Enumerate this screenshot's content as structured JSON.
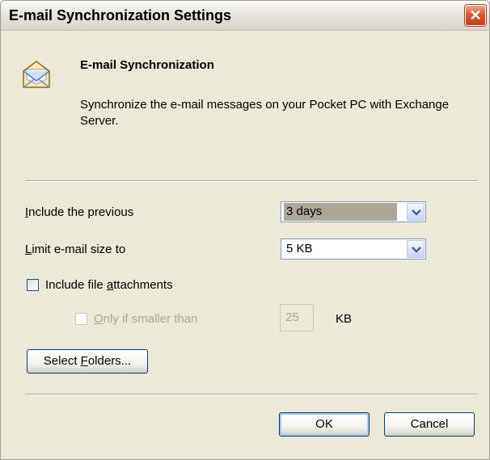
{
  "window": {
    "title": "E-mail Synchronization Settings",
    "close_glyph": "✕"
  },
  "header": {
    "icon": "envelope-icon",
    "heading": "E-mail Synchronization",
    "description": "Synchronize the e-mail messages on your Pocket PC with Exchange Server."
  },
  "form": {
    "include_previous": {
      "label_accesskey": "I",
      "label_rest": "nclude the previous",
      "value": "3 days"
    },
    "limit_size": {
      "label_accesskey": "L",
      "label_rest": "imit e-mail size to",
      "value": "5 KB"
    },
    "include_attachments": {
      "label_pre": "Include file ",
      "label_accesskey": "a",
      "label_post": "ttachments",
      "checked": false
    },
    "only_if_smaller": {
      "label_accesskey": "O",
      "label_rest": "nly if smaller than",
      "checked": false,
      "enabled": false,
      "size_value": "25",
      "unit": "KB"
    }
  },
  "buttons": {
    "select_folders_pre": "Select ",
    "select_folders_accesskey": "F",
    "select_folders_post": "olders...",
    "ok": "OK",
    "cancel": "Cancel"
  },
  "colors": {
    "dialog_bg": "#ece9d8",
    "close_button": "#d5542d",
    "disabled_text": "#aca899",
    "combo_border": "#7f9db9"
  }
}
